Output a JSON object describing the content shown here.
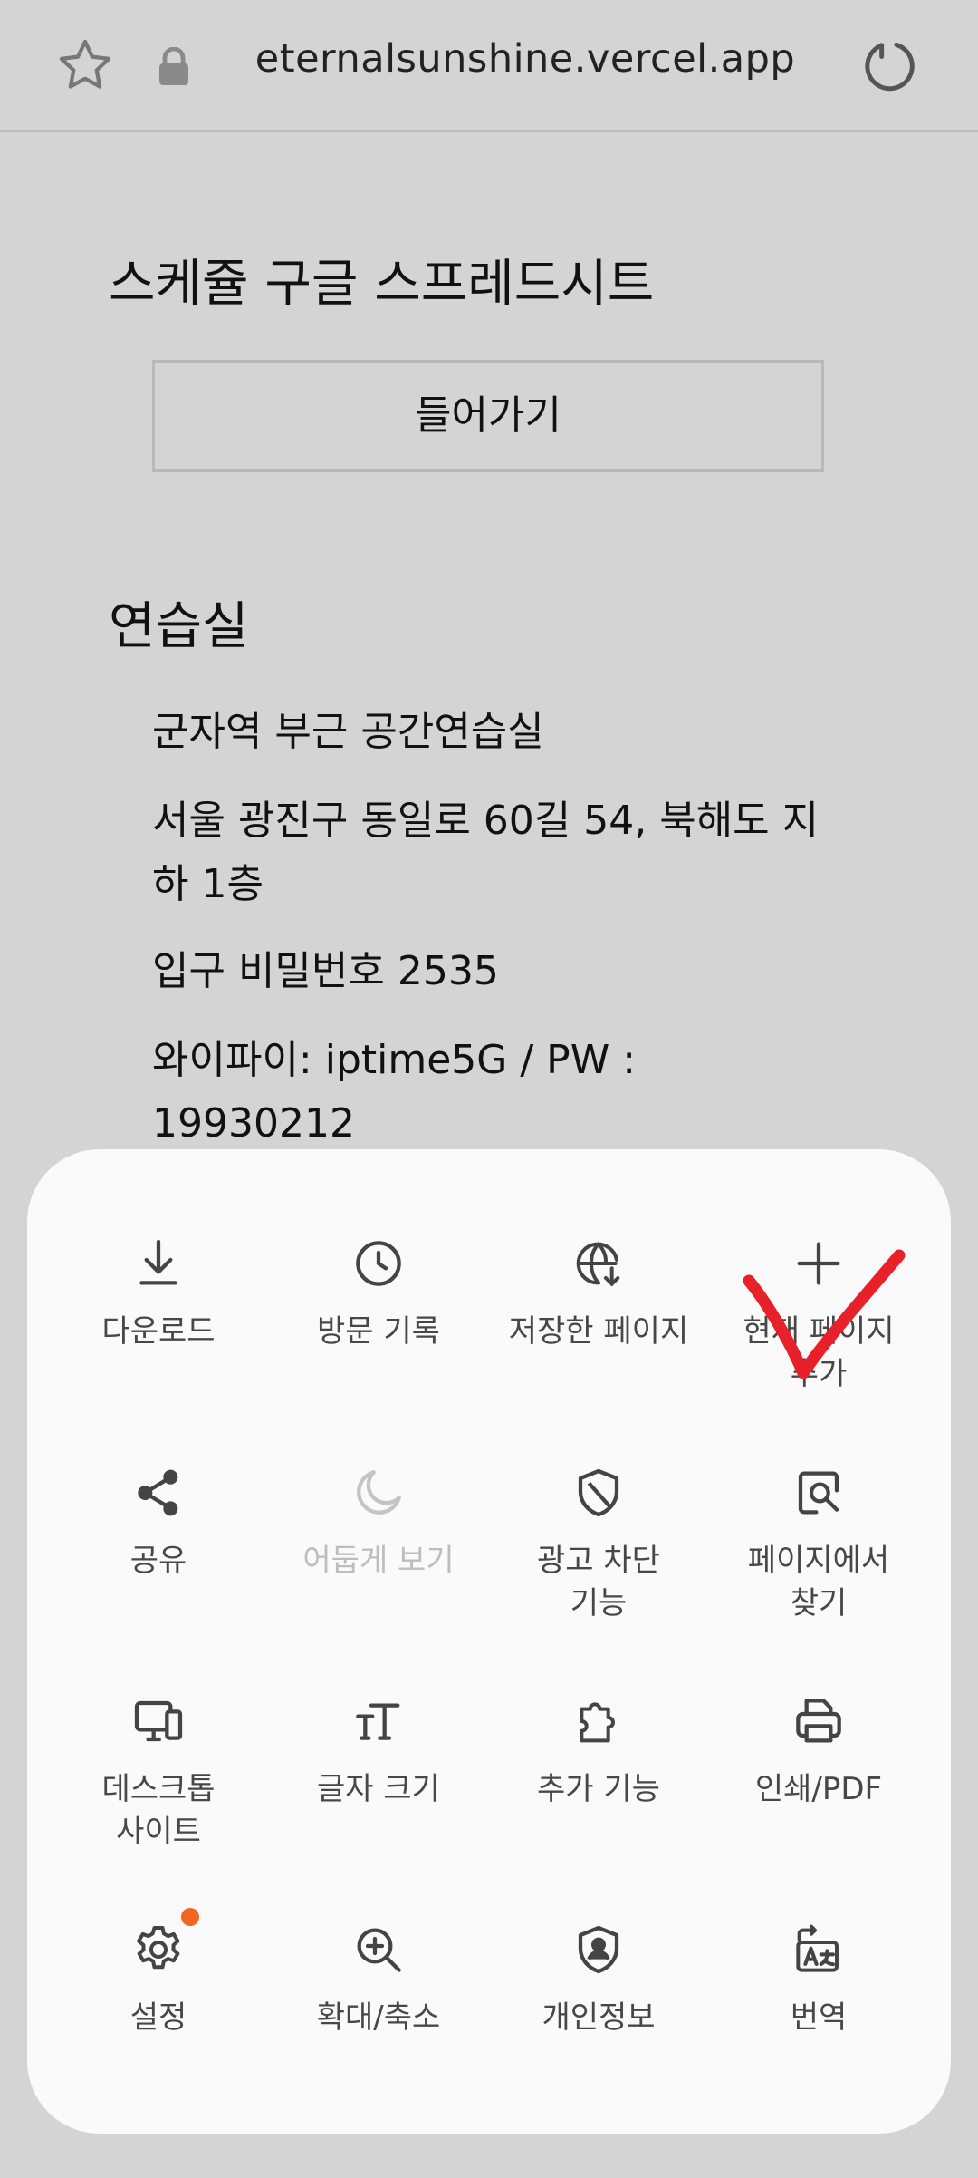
{
  "browser": {
    "url": "eternalsunshine.vercel.app"
  },
  "page": {
    "schedule_heading": "스케쥴 구글 스프레드시트",
    "enter_button": "들어가기",
    "practice_heading": "연습실",
    "practice_lines": [
      "군자역 부근 공간연습실",
      "서울 광진구 동일로 60길 54, 북해도 지하 1층",
      "입구 비밀번호 2535",
      "와이파이: iptime5G / PW : 19930212"
    ]
  },
  "menu": {
    "items": [
      {
        "label": "다운로드",
        "icon": "download-icon"
      },
      {
        "label": "방문 기록",
        "icon": "clock-icon"
      },
      {
        "label": "저장한 페이지",
        "icon": "globe-download-icon"
      },
      {
        "label": "현재 페이지\n추가",
        "icon": "plus-icon"
      },
      {
        "label": "공유",
        "icon": "share-icon"
      },
      {
        "label": "어둡게 보기",
        "icon": "moon-icon",
        "disabled": true
      },
      {
        "label": "광고 차단\n기능",
        "icon": "shield-slash-icon"
      },
      {
        "label": "페이지에서\n찾기",
        "icon": "find-in-page-icon"
      },
      {
        "label": "데스크톱\n사이트",
        "icon": "desktop-icon"
      },
      {
        "label": "글자 크기",
        "icon": "text-size-icon"
      },
      {
        "label": "추가 기능",
        "icon": "puzzle-icon"
      },
      {
        "label": "인쇄/PDF",
        "icon": "print-icon"
      },
      {
        "label": "설정",
        "icon": "gear-icon",
        "badge": true
      },
      {
        "label": "확대/축소",
        "icon": "zoom-icon"
      },
      {
        "label": "개인정보",
        "icon": "privacy-shield-icon"
      },
      {
        "label": "번역",
        "icon": "translate-icon"
      }
    ]
  },
  "colors": {
    "background": "#d4d4d4",
    "sheet": "#fafafa",
    "badge": "#f26522",
    "annotation": "#e8202a"
  }
}
